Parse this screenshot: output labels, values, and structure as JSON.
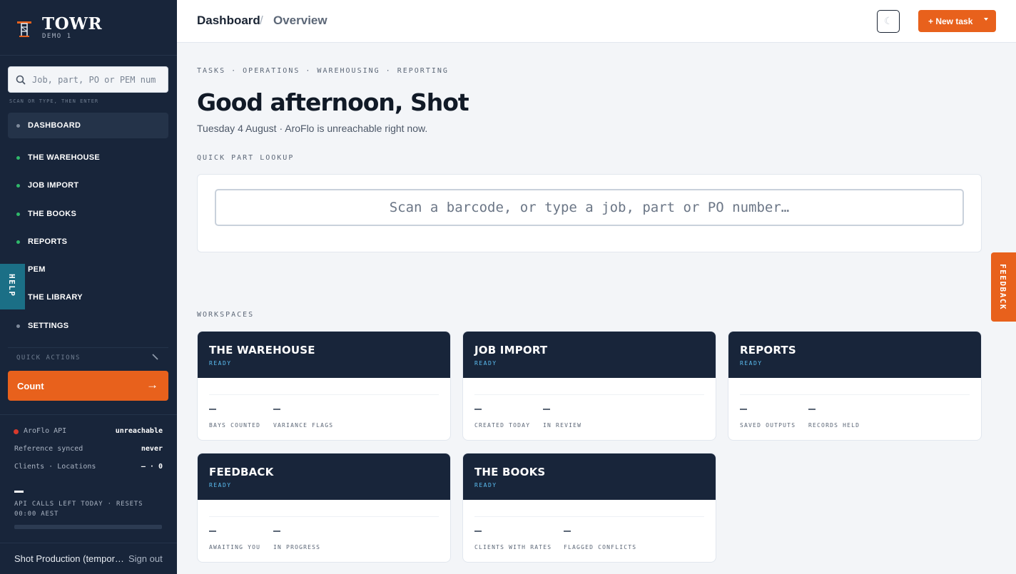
{
  "brand": {
    "name": "TOWR",
    "subtitle": "DEMO 1"
  },
  "sidebar": {
    "search_placeholder": "Job, part, PO or PEM num",
    "search_hint": "SCAN OR TYPE, THEN ENTER",
    "nav": [
      {
        "label": "DASHBOARD",
        "dot": "#7e8a9b",
        "active": true
      },
      {
        "label": "THE WAREHOUSE",
        "dot": "#2fb86a"
      },
      {
        "label": "JOB IMPORT",
        "dot": "#2fb86a"
      },
      {
        "label": "THE BOOKS",
        "dot": "#2fb86a"
      },
      {
        "label": "REPORTS",
        "dot": "#2fb86a"
      },
      {
        "label": "PEM",
        "dot": "#2fb86a"
      },
      {
        "label": "THE LIBRARY",
        "dot": "#2fb86a"
      },
      {
        "label": "SETTINGS",
        "dot": "#7e8a9b"
      }
    ],
    "help_label": "HELP",
    "quick_actions_label": "QUICK ACTIONS",
    "quick_action": {
      "label": "Count",
      "arrow": "→"
    },
    "status": [
      {
        "key": "AroFlo API",
        "value": "unreachable"
      },
      {
        "key": "Reference synced",
        "value": "never"
      },
      {
        "key": "Clients · Locations",
        "value": "— · 0"
      }
    ],
    "quota_text": "API CALLS LEFT TODAY · RESETS 00:00 AEST",
    "user": "Shot Production (temporary)",
    "sign_out": "Sign out"
  },
  "topbar": {
    "breadcrumb": [
      "Dashboard",
      "Overview"
    ],
    "separator": "/",
    "theme_icon": "☾",
    "new_task": "+ New task"
  },
  "main": {
    "tags": "TASKS · OPERATIONS · WAREHOUSING · REPORTING",
    "greeting": "Good afternoon, Shot",
    "subline": "Tuesday 4 August · AroFlo is unreachable right now.",
    "lookup_label": "QUICK PART LOOKUP",
    "lookup_placeholder": "Scan a barcode, or type a job, part or PO number…",
    "workspaces_label": "WORKSPACES",
    "workspaces": [
      {
        "title": "THE WAREHOUSE",
        "status": "READY",
        "stats": [
          "BAYS COUNTED",
          "VARIANCE FLAGS"
        ]
      },
      {
        "title": "JOB IMPORT",
        "status": "READY",
        "stats": [
          "CREATED TODAY",
          "IN REVIEW"
        ]
      },
      {
        "title": "REPORTS",
        "status": "READY",
        "stats": [
          "SAVED OUTPUTS",
          "RECORDS HELD"
        ]
      },
      {
        "title": "FEEDBACK",
        "status": "READY",
        "stats": [
          "AWAITING YOU",
          "IN PROGRESS"
        ]
      },
      {
        "title": "THE BOOKS",
        "status": "READY",
        "stats": [
          "CLIENTS WITH RATES",
          "FLAGGED CONFLICTS"
        ]
      }
    ]
  },
  "feedback_tab": "FEEDBACK",
  "colors": {
    "accent": "#e8611c",
    "navy": "#18253a",
    "ready": "#5bbcf0",
    "error": "#d83a2c"
  }
}
